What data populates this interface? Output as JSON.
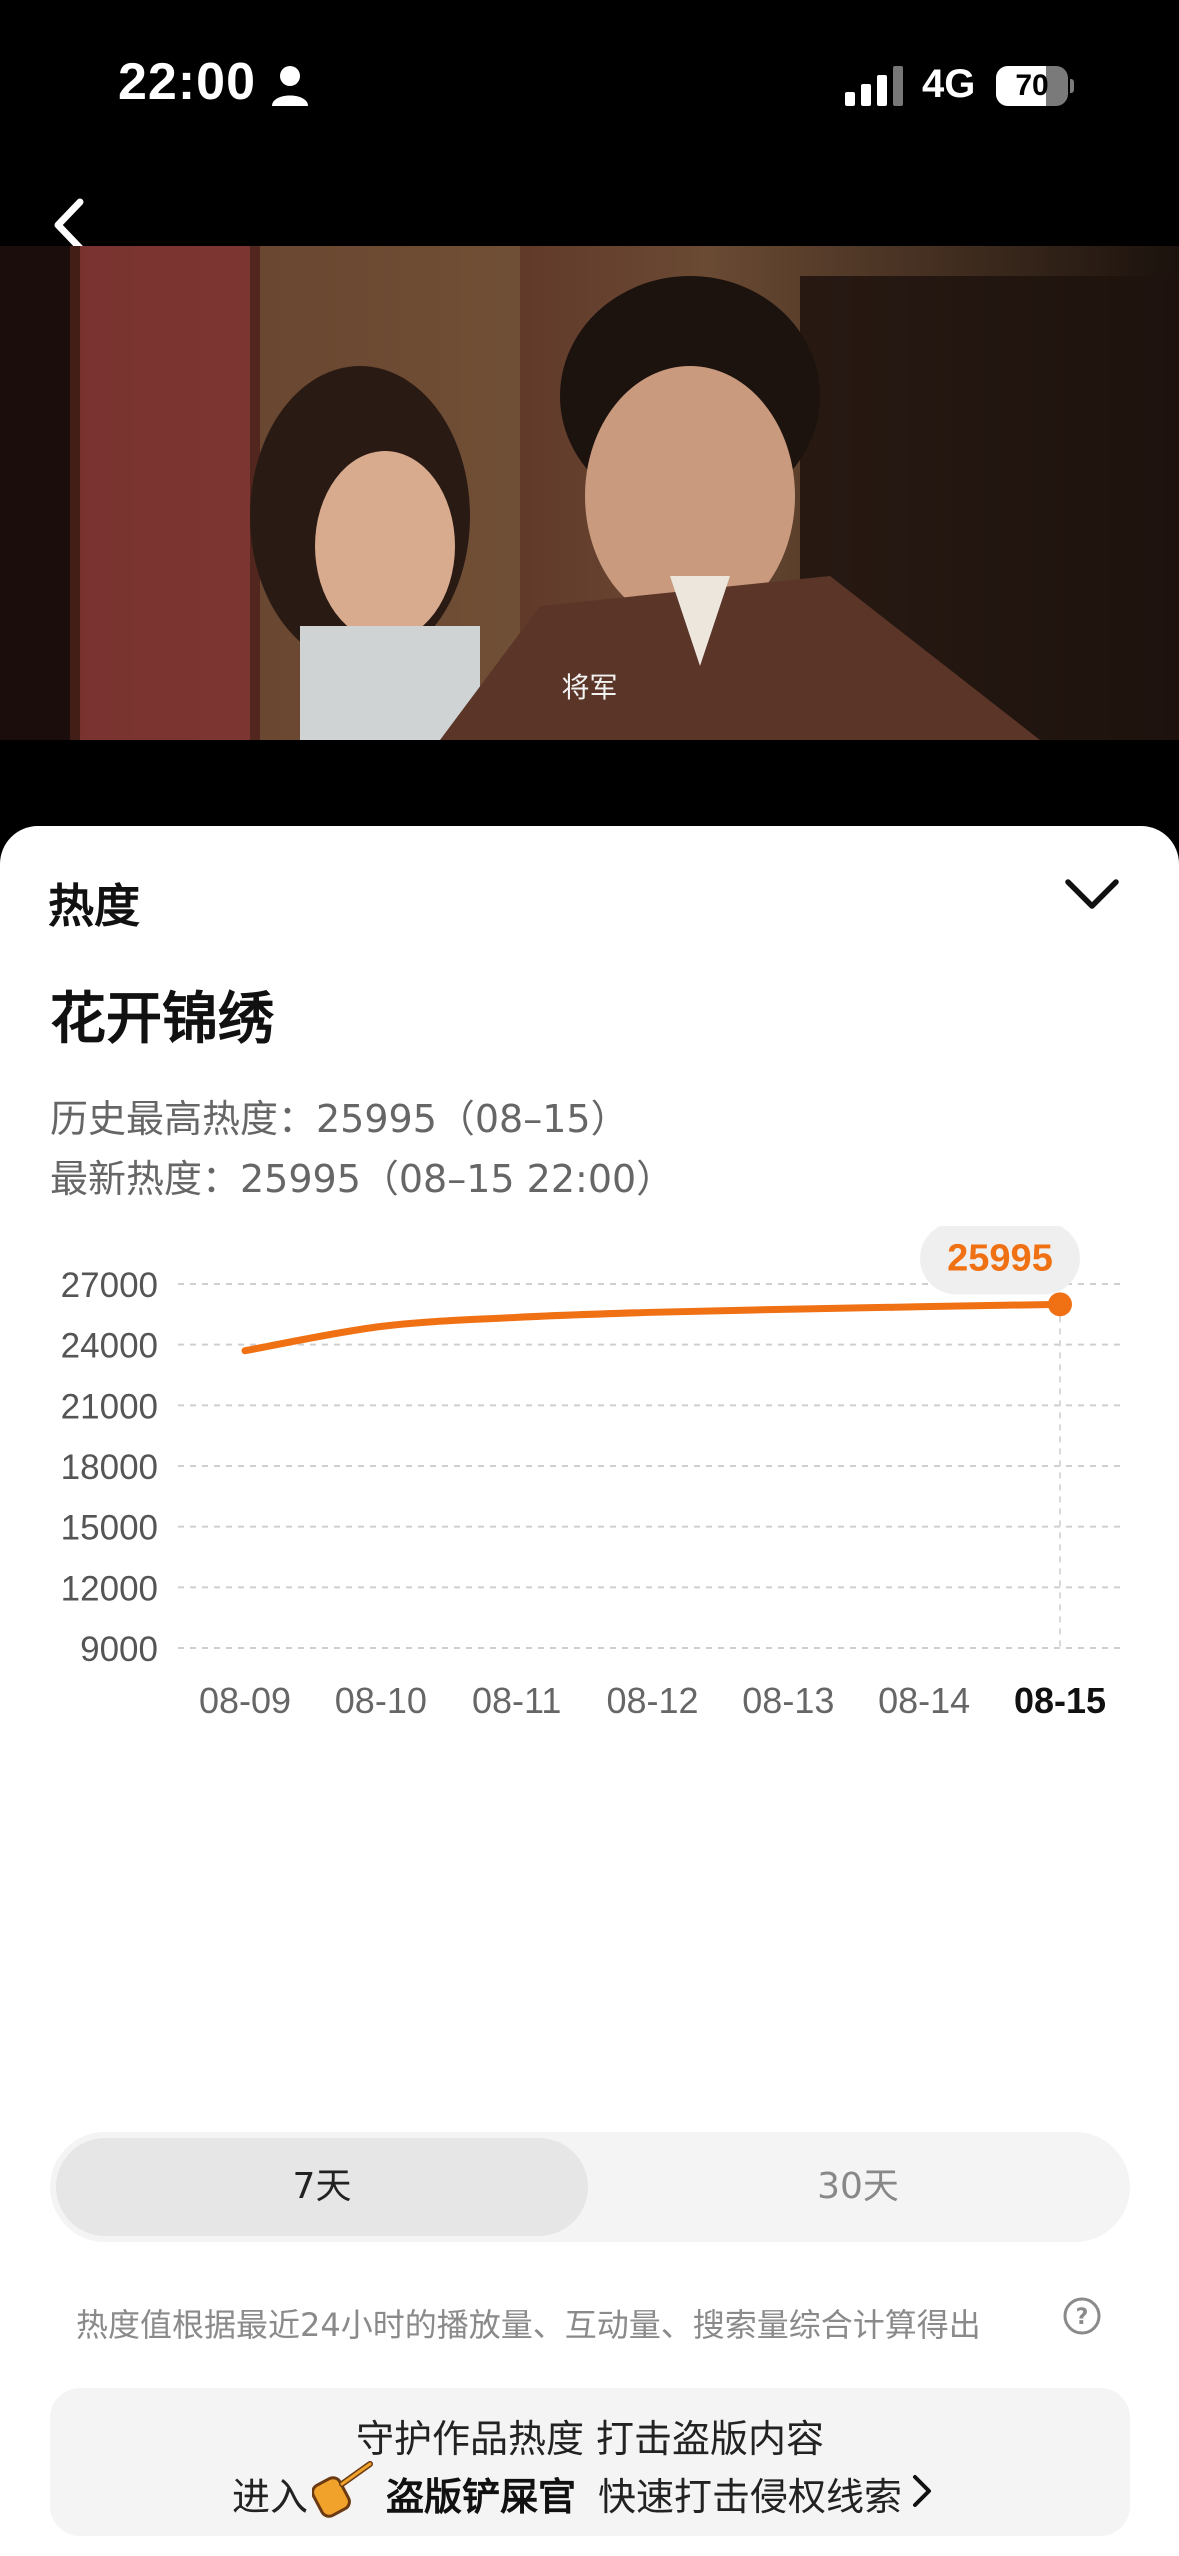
{
  "status": {
    "time": "22:00",
    "network": "4G",
    "battery": "70"
  },
  "video": {
    "subtitle": "将军"
  },
  "sheet": {
    "title": "热度",
    "show_title": "花开锦绣",
    "history_high": "历史最高热度：25995（08–15）",
    "latest": "最新热度：25995（08–15 22:00）"
  },
  "chart_data": {
    "type": "line",
    "x": [
      "08-09",
      "08-10",
      "08-11",
      "08-12",
      "08-13",
      "08-14",
      "08-15"
    ],
    "series": [
      {
        "values": [
          23700,
          24900,
          25350,
          25600,
          25750,
          25880,
          25995
        ]
      }
    ],
    "ylim": [
      9000,
      27000
    ],
    "yticks": [
      27000,
      24000,
      21000,
      18000,
      15000,
      12000,
      9000
    ],
    "highlight_label": "25995",
    "grid": true,
    "line_color": "#F07014"
  },
  "tabs": {
    "seven_days": "7天",
    "thirty_days": "30天"
  },
  "footnote": "热度值根据最近24小时的播放量、互动量、搜索量综合计算得出",
  "promo": {
    "line1": "守护作品热度 打击盗版内容",
    "enter": "进入",
    "brand": "盗版铲屎官",
    "action": "快速打击侵权线索"
  },
  "colors": {
    "accent": "#F07014",
    "sheet_bg": "#FFFFFF",
    "tab_active_bg": "#E6E6E6"
  }
}
